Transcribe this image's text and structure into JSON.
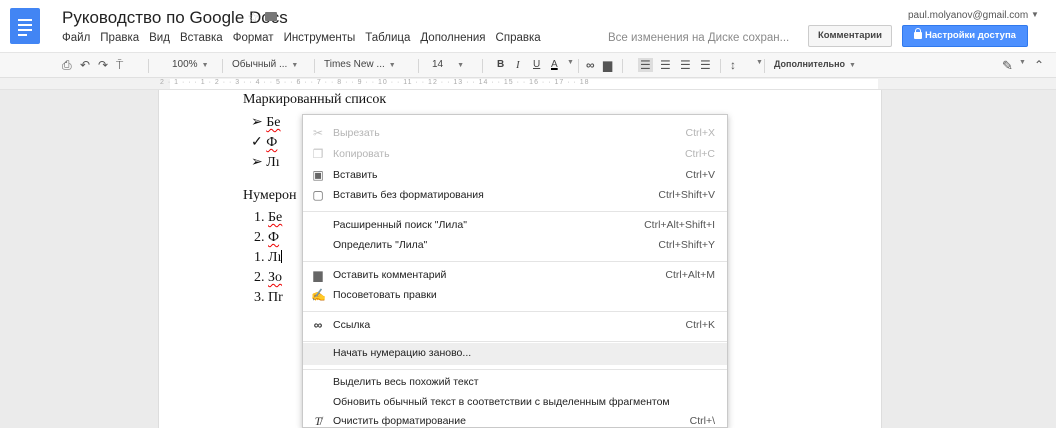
{
  "header": {
    "title": "Руководство по Google Docs",
    "menu": [
      "Файл",
      "Правка",
      "Вид",
      "Вставка",
      "Формат",
      "Инструменты",
      "Таблица",
      "Дополнения",
      "Справка"
    ],
    "save_status": "Все изменения на Диске сохран...",
    "account": "paul.molyanov@gmail.com",
    "comments_button": "Комментарии",
    "share_button": "Настройки доступа"
  },
  "toolbar": {
    "zoom": "100%",
    "style": "Обычный ...",
    "font": "Times New ...",
    "font_size": "14",
    "bold": "B",
    "italic": "I",
    "underline": "U",
    "text_color": "A",
    "more": "Дополнительно"
  },
  "ruler": {
    "numbers": "2 · 1 · · · 1 · 2 · · 3 · · 4 · · 5 · · 6 · · 7 · · 8 · · 9 · · 10 · · 11 · · 12 · · 13 · · 14 · · 15 · · 16 · · 17 · · 18"
  },
  "document": {
    "heading_bullets": "Маркированный список",
    "bullets": [
      {
        "marker": "➢",
        "text": "Бе"
      },
      {
        "marker": "✓",
        "text": "Ф"
      },
      {
        "marker": "➢",
        "text": "Лı"
      }
    ],
    "heading_numbered": "Нумерон",
    "numbered": [
      {
        "marker": "1.",
        "text": "Бе"
      },
      {
        "marker": "2.",
        "text": "Ф"
      },
      {
        "marker": "1.",
        "text": "Лı"
      },
      {
        "marker": "2.",
        "text": "Зо"
      },
      {
        "marker": "3.",
        "text": "Пr"
      }
    ]
  },
  "context_menu": {
    "cut": {
      "label": "Вырезать",
      "shortcut": "Ctrl+X"
    },
    "copy": {
      "label": "Копировать",
      "shortcut": "Ctrl+C"
    },
    "paste": {
      "label": "Вставить",
      "shortcut": "Ctrl+V"
    },
    "paste_plain": {
      "label": "Вставить без форматирования",
      "shortcut": "Ctrl+Shift+V"
    },
    "research": {
      "label": "Расширенный поиск \"Лила\"",
      "shortcut": "Ctrl+Alt+Shift+I"
    },
    "define": {
      "label": "Определить \"Лила\"",
      "shortcut": "Ctrl+Shift+Y"
    },
    "comment": {
      "label": "Оставить комментарий",
      "shortcut": "Ctrl+Alt+M"
    },
    "suggest": {
      "label": "Посоветовать правки",
      "shortcut": ""
    },
    "link": {
      "label": "Ссылка",
      "shortcut": "Ctrl+K"
    },
    "restart_numbering": {
      "label": "Начать нумерацию заново...",
      "shortcut": ""
    },
    "select_similar": {
      "label": "Выделить весь похожий текст",
      "shortcut": ""
    },
    "update_style": {
      "label": "Обновить обычный текст в соответствии с выделенным фрагментом",
      "shortcut": ""
    },
    "clear_format": {
      "label": "Очистить форматирование",
      "shortcut": "Ctrl+\\"
    }
  }
}
